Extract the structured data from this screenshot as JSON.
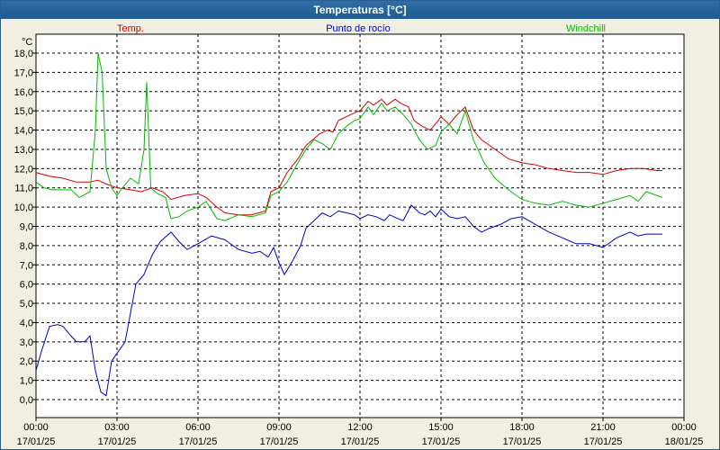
{
  "window": {
    "title": "Temperaturas [°C]"
  },
  "chart_data": {
    "type": "line",
    "title": "Temperaturas [°C]",
    "ylabel": "°C",
    "ylim": [
      -1,
      19
    ],
    "xlim": [
      0,
      24
    ],
    "grid": true,
    "legend_position": "top",
    "y_ticks": [
      "0,0",
      "1,0",
      "2,0",
      "3,0",
      "4,0",
      "5,0",
      "6,0",
      "7,0",
      "8,0",
      "9,0",
      "10,0",
      "11,0",
      "12,0",
      "13,0",
      "14,0",
      "15,0",
      "16,0",
      "17,0",
      "18,0"
    ],
    "x_ticks": [
      {
        "time": "00:00",
        "date": "17/01/25"
      },
      {
        "time": "03:00",
        "date": "17/01/25"
      },
      {
        "time": "06:00",
        "date": "17/01/25"
      },
      {
        "time": "09:00",
        "date": "17/01/25"
      },
      {
        "time": "12:00",
        "date": "17/01/25"
      },
      {
        "time": "15:00",
        "date": "17/01/25"
      },
      {
        "time": "18:00",
        "date": "17/01/25"
      },
      {
        "time": "21:00",
        "date": "17/01/25"
      },
      {
        "time": "00:00",
        "date": "18/01/25"
      }
    ],
    "series": [
      {
        "name": "Temp.",
        "color": "#d40000",
        "points": [
          [
            0.0,
            11.8
          ],
          [
            0.5,
            11.6
          ],
          [
            1.0,
            11.5
          ],
          [
            1.5,
            11.3
          ],
          [
            2.0,
            11.3
          ],
          [
            2.3,
            11.4
          ],
          [
            2.6,
            11.2
          ],
          [
            3.0,
            11.0
          ],
          [
            3.5,
            10.9
          ],
          [
            3.9,
            10.8
          ],
          [
            4.3,
            11.0
          ],
          [
            4.7,
            10.8
          ],
          [
            5.0,
            10.4
          ],
          [
            5.5,
            10.6
          ],
          [
            6.0,
            10.7
          ],
          [
            6.3,
            10.5
          ],
          [
            6.7,
            10.0
          ],
          [
            7.0,
            9.7
          ],
          [
            7.5,
            9.6
          ],
          [
            8.0,
            9.6
          ],
          [
            8.5,
            9.8
          ],
          [
            8.7,
            10.8
          ],
          [
            9.0,
            11.0
          ],
          [
            9.3,
            11.8
          ],
          [
            9.7,
            12.5
          ],
          [
            10.0,
            13.2
          ],
          [
            10.5,
            13.8
          ],
          [
            10.8,
            14.0
          ],
          [
            11.0,
            13.9
          ],
          [
            11.2,
            14.5
          ],
          [
            11.5,
            14.7
          ],
          [
            11.8,
            14.9
          ],
          [
            12.0,
            15.0
          ],
          [
            12.3,
            15.5
          ],
          [
            12.5,
            15.3
          ],
          [
            12.8,
            15.6
          ],
          [
            13.0,
            15.3
          ],
          [
            13.3,
            15.6
          ],
          [
            13.5,
            15.4
          ],
          [
            13.8,
            15.2
          ],
          [
            14.0,
            14.5
          ],
          [
            14.3,
            14.2
          ],
          [
            14.6,
            14.0
          ],
          [
            14.9,
            14.5
          ],
          [
            15.0,
            14.7
          ],
          [
            15.3,
            14.3
          ],
          [
            15.6,
            14.8
          ],
          [
            15.9,
            15.2
          ],
          [
            16.2,
            14.0
          ],
          [
            16.5,
            13.5
          ],
          [
            17.0,
            13.0
          ],
          [
            17.5,
            12.5
          ],
          [
            18.0,
            12.3
          ],
          [
            18.5,
            12.2
          ],
          [
            19.0,
            12.0
          ],
          [
            19.5,
            11.9
          ],
          [
            20.0,
            11.8
          ],
          [
            20.5,
            11.8
          ],
          [
            21.0,
            11.7
          ],
          [
            21.5,
            11.9
          ],
          [
            22.0,
            12.0
          ],
          [
            22.5,
            12.0
          ],
          [
            23.0,
            11.9
          ],
          [
            23.2,
            11.9
          ]
        ]
      },
      {
        "name": "Punto de rocío",
        "color": "#0000cc",
        "points": [
          [
            0.0,
            1.5
          ],
          [
            0.2,
            2.5
          ],
          [
            0.5,
            3.8
          ],
          [
            0.8,
            3.9
          ],
          [
            1.0,
            3.8
          ],
          [
            1.3,
            3.3
          ],
          [
            1.5,
            3.0
          ],
          [
            1.8,
            3.0
          ],
          [
            2.0,
            3.3
          ],
          [
            2.2,
            1.5
          ],
          [
            2.4,
            0.4
          ],
          [
            2.6,
            0.2
          ],
          [
            2.8,
            2.0
          ],
          [
            3.0,
            2.4
          ],
          [
            3.3,
            3.0
          ],
          [
            3.5,
            4.5
          ],
          [
            3.7,
            6.0
          ],
          [
            4.0,
            6.5
          ],
          [
            4.3,
            7.5
          ],
          [
            4.6,
            8.2
          ],
          [
            5.0,
            8.7
          ],
          [
            5.3,
            8.2
          ],
          [
            5.6,
            7.8
          ],
          [
            6.0,
            8.1
          ],
          [
            6.5,
            8.5
          ],
          [
            7.0,
            8.3
          ],
          [
            7.5,
            7.8
          ],
          [
            8.0,
            7.6
          ],
          [
            8.3,
            7.7
          ],
          [
            8.6,
            7.4
          ],
          [
            8.8,
            7.9
          ],
          [
            9.0,
            7.1
          ],
          [
            9.2,
            6.5
          ],
          [
            9.5,
            7.2
          ],
          [
            9.8,
            8.0
          ],
          [
            10.0,
            8.9
          ],
          [
            10.3,
            9.3
          ],
          [
            10.6,
            9.7
          ],
          [
            10.9,
            9.5
          ],
          [
            11.2,
            9.8
          ],
          [
            11.5,
            9.7
          ],
          [
            11.8,
            9.6
          ],
          [
            12.0,
            9.4
          ],
          [
            12.3,
            9.6
          ],
          [
            12.6,
            9.5
          ],
          [
            12.9,
            9.3
          ],
          [
            13.1,
            9.6
          ],
          [
            13.4,
            9.4
          ],
          [
            13.6,
            9.3
          ],
          [
            13.9,
            10.1
          ],
          [
            14.2,
            9.7
          ],
          [
            14.4,
            9.6
          ],
          [
            14.6,
            9.8
          ],
          [
            14.8,
            9.5
          ],
          [
            15.0,
            9.9
          ],
          [
            15.3,
            9.5
          ],
          [
            15.6,
            9.4
          ],
          [
            15.9,
            9.5
          ],
          [
            16.2,
            9.0
          ],
          [
            16.5,
            8.7
          ],
          [
            16.8,
            8.9
          ],
          [
            17.2,
            9.1
          ],
          [
            17.6,
            9.4
          ],
          [
            18.0,
            9.5
          ],
          [
            18.5,
            9.1
          ],
          [
            19.0,
            8.7
          ],
          [
            19.5,
            8.4
          ],
          [
            20.0,
            8.1
          ],
          [
            20.5,
            8.1
          ],
          [
            21.0,
            7.9
          ],
          [
            21.5,
            8.4
          ],
          [
            22.0,
            8.7
          ],
          [
            22.3,
            8.5
          ],
          [
            22.6,
            8.6
          ],
          [
            23.2,
            8.6
          ]
        ]
      },
      {
        "name": "Windchill",
        "color": "#00bb00",
        "points": [
          [
            0.0,
            11.3
          ],
          [
            0.3,
            11.0
          ],
          [
            0.6,
            10.9
          ],
          [
            1.0,
            10.9
          ],
          [
            1.3,
            10.9
          ],
          [
            1.6,
            10.5
          ],
          [
            2.0,
            10.8
          ],
          [
            2.2,
            14.0
          ],
          [
            2.3,
            18.0
          ],
          [
            2.45,
            17.0
          ],
          [
            2.6,
            12.0
          ],
          [
            2.8,
            11.0
          ],
          [
            3.0,
            10.6
          ],
          [
            3.2,
            11.0
          ],
          [
            3.5,
            11.5
          ],
          [
            3.8,
            11.2
          ],
          [
            4.0,
            13.0
          ],
          [
            4.1,
            16.5
          ],
          [
            4.25,
            11.0
          ],
          [
            4.5,
            10.7
          ],
          [
            4.8,
            10.5
          ],
          [
            5.0,
            9.4
          ],
          [
            5.3,
            9.5
          ],
          [
            5.6,
            9.8
          ],
          [
            6.0,
            10.0
          ],
          [
            6.3,
            10.3
          ],
          [
            6.7,
            9.4
          ],
          [
            7.0,
            9.3
          ],
          [
            7.5,
            9.6
          ],
          [
            8.0,
            9.5
          ],
          [
            8.5,
            9.7
          ],
          [
            8.7,
            10.6
          ],
          [
            9.0,
            10.8
          ],
          [
            9.3,
            11.3
          ],
          [
            9.7,
            12.3
          ],
          [
            10.0,
            13.0
          ],
          [
            10.3,
            13.5
          ],
          [
            10.6,
            13.3
          ],
          [
            10.9,
            13.0
          ],
          [
            11.2,
            13.8
          ],
          [
            11.5,
            14.2
          ],
          [
            11.8,
            14.5
          ],
          [
            12.0,
            14.6
          ],
          [
            12.3,
            15.2
          ],
          [
            12.5,
            14.8
          ],
          [
            12.8,
            15.4
          ],
          [
            13.0,
            15.0
          ],
          [
            13.3,
            15.2
          ],
          [
            13.6,
            14.8
          ],
          [
            13.9,
            14.3
          ],
          [
            14.2,
            13.5
          ],
          [
            14.5,
            13.0
          ],
          [
            14.8,
            13.2
          ],
          [
            15.0,
            13.9
          ],
          [
            15.3,
            14.3
          ],
          [
            15.6,
            13.8
          ],
          [
            15.9,
            15.0
          ],
          [
            16.2,
            13.5
          ],
          [
            16.6,
            12.3
          ],
          [
            17.0,
            11.5
          ],
          [
            17.5,
            10.9
          ],
          [
            18.0,
            10.4
          ],
          [
            18.5,
            10.2
          ],
          [
            19.0,
            10.1
          ],
          [
            19.5,
            10.3
          ],
          [
            20.0,
            10.1
          ],
          [
            20.5,
            10.0
          ],
          [
            21.0,
            10.2
          ],
          [
            21.5,
            10.4
          ],
          [
            22.0,
            10.6
          ],
          [
            22.3,
            10.3
          ],
          [
            22.6,
            10.8
          ],
          [
            23.2,
            10.5
          ]
        ]
      }
    ]
  }
}
